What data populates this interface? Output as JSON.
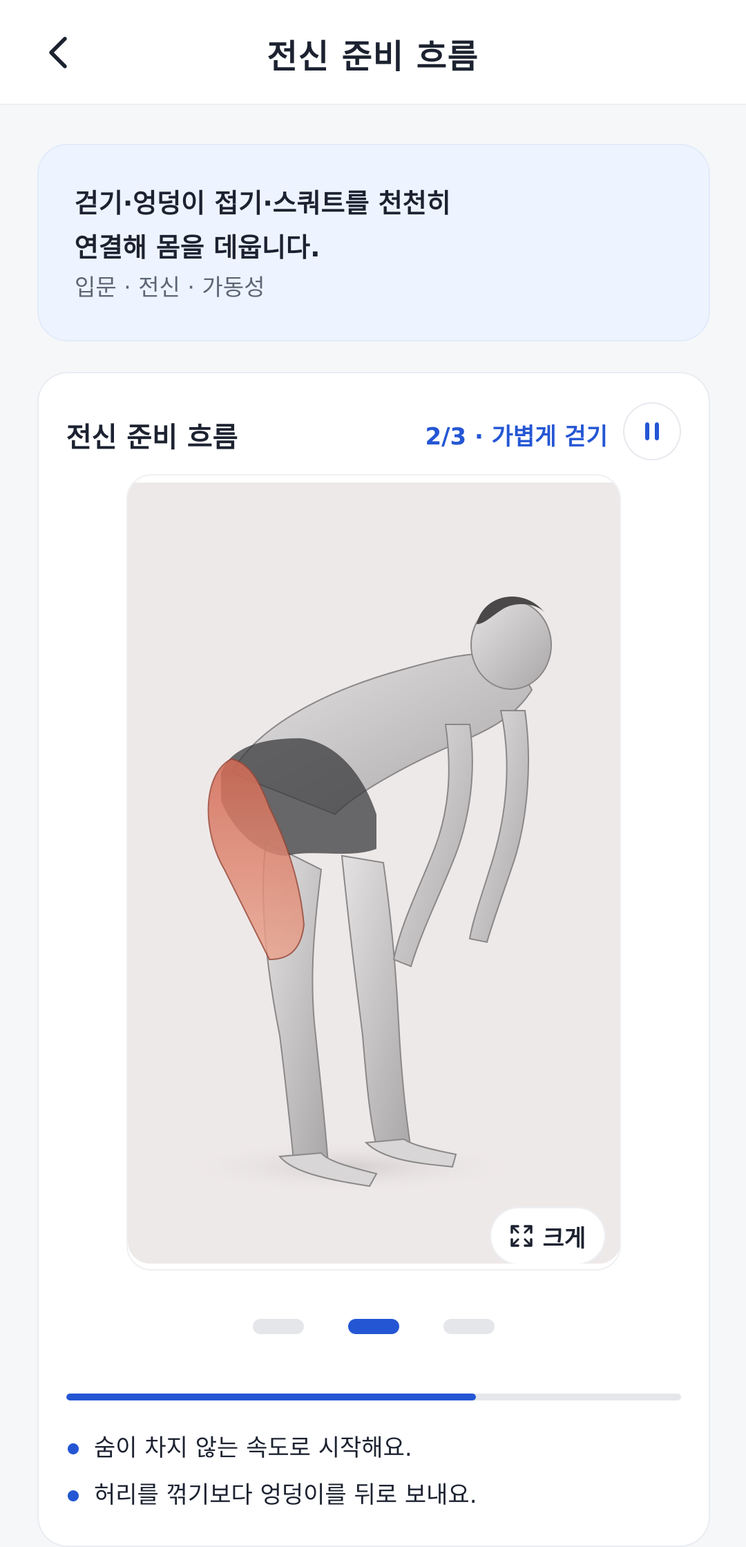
{
  "header": {
    "title": "전신 준비 흐름",
    "back_icon": "chevron-left-icon"
  },
  "intro": {
    "description": "걷기·엉덩이 접기·스쿼트를 천천히 연결해 몸을 데웁니다.",
    "tags": "입문 · 전신 · 가동성"
  },
  "player": {
    "title": "전신 준비 흐름",
    "step_label": "2/3 · 가볍게 걷기",
    "pause_icon": "pause-icon",
    "enlarge_label": "크게",
    "enlarge_icon": "expand-icon",
    "current_step": 2,
    "total_steps": 3,
    "progress_fraction": 0.666
  },
  "tips": [
    "숨이 차지 않는 속도로 시작해요.",
    "허리를 꺾기보다 엉덩이를 뒤로 보내요."
  ],
  "colors": {
    "accent": "#2456d4",
    "intro_bg": "#edf4ff",
    "highlight_muscle": "#d97a64"
  }
}
